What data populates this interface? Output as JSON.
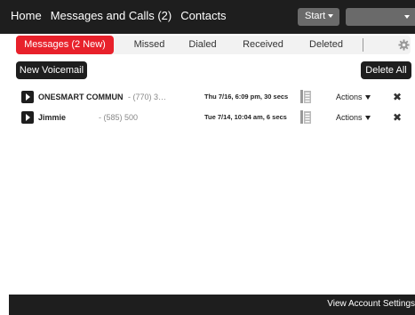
{
  "nav": {
    "home": "Home",
    "messages_calls": "Messages and Calls (2)",
    "contacts": "Contacts",
    "start": "Start",
    "account": ""
  },
  "tabs": [
    {
      "label": "Messages (2 New)",
      "active": true
    },
    {
      "label": "Missed",
      "active": false
    },
    {
      "label": "Dialed",
      "active": false
    },
    {
      "label": "Received",
      "active": false
    },
    {
      "label": "Deleted",
      "active": false
    }
  ],
  "toolbar": {
    "new_voicemail": "New Voicemail",
    "delete_all": "Delete All"
  },
  "voicemails": [
    {
      "name": "ONESMART COMMUN",
      "number": "- (770) 3…",
      "date": "Thu 7/16, 6:09 pm, 30 secs",
      "actions": "Actions"
    },
    {
      "name": "Jimmie",
      "number": "- (585) 500",
      "date": "Tue 7/14, 10:04 am, 6 secs",
      "actions": "Actions"
    }
  ],
  "footer": {
    "view_account_settings": "View Account Settings"
  },
  "colors": {
    "accent": "#e8212b",
    "dark": "#1e1e1e",
    "gray_button": "#6a6a6a"
  }
}
